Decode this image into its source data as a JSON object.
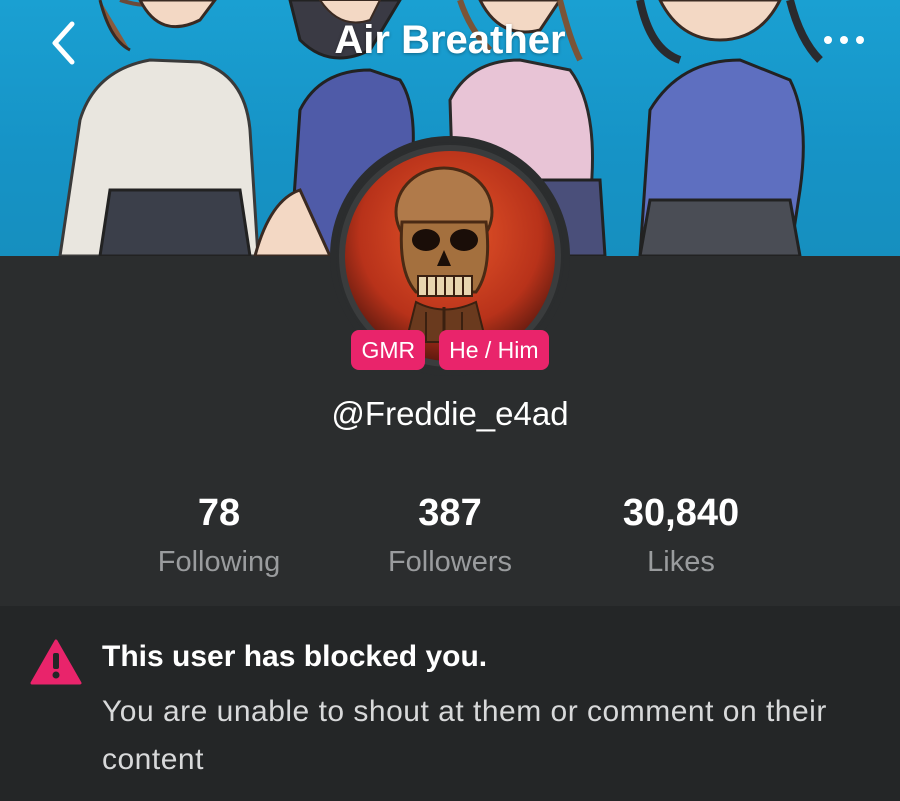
{
  "header": {
    "title": "Air Breather",
    "back_icon": "chevron-left-icon",
    "more_icon": "more-horizontal-icon"
  },
  "profile": {
    "badges": [
      "GMR",
      "He / Him"
    ],
    "username": "@Freddie_e4ad",
    "avatar": "skull-avatar"
  },
  "stats": [
    {
      "value": "78",
      "label": "Following"
    },
    {
      "value": "387",
      "label": "Followers"
    },
    {
      "value": "30,840",
      "label": "Likes"
    }
  ],
  "notice": {
    "icon": "warning-triangle-icon",
    "title": "This user has blocked you.",
    "message": "You are unable to shout at them or comment on their content"
  },
  "colors": {
    "accent": "#e9246b",
    "background": "#2b2d2e",
    "notice_background": "#242627"
  }
}
